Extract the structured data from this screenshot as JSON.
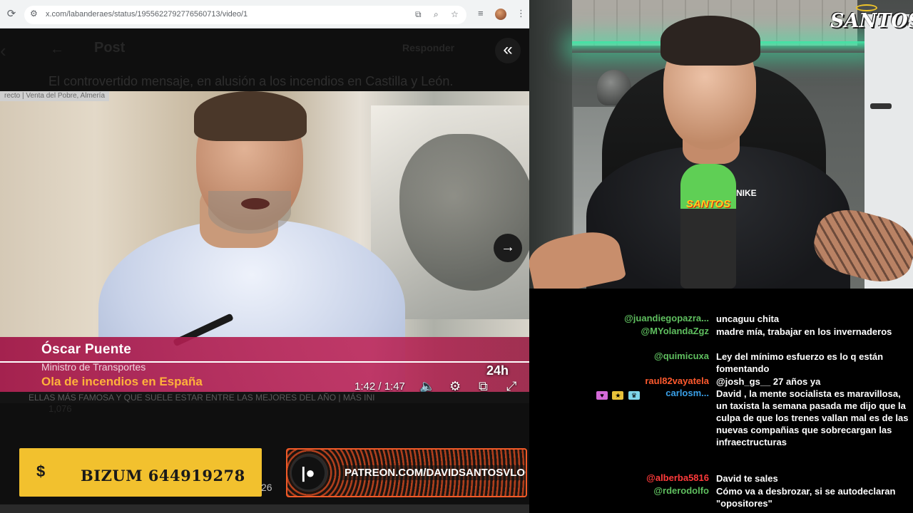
{
  "browser": {
    "url": "x.com/labanderaes/status/1955622792776560713/video/1",
    "dim_back": "←",
    "dim_post_title": "Post",
    "dim_reply": "Responder",
    "dim_caption": "El controvertido mensaje, en alusión a los incendios en Castilla y León.",
    "dim_stats": "1,076"
  },
  "video": {
    "live_tag": "recto | Venta del Pobre, Almería",
    "person_name": "Óscar Puente",
    "person_role": "Ministro de Transportes",
    "topic": "Ola de incendios en España",
    "channel_logo": "24h",
    "time": "1:42 / 1:47",
    "ticker": "ELLAS MÁS FAMOSA Y QUE SUELE ESTAR ENTRE LAS MEJORES DEL AÑO | MÁS INI"
  },
  "overlays": {
    "bizum_symbol": "$",
    "bizum_text": "BIZUM 644919278",
    "bizum_badge": "26",
    "patreon_symbol": "|●",
    "patreon_text": "PATREON.COM/DAVIDSANTOSVLOG"
  },
  "webcam": {
    "logo": "SANTOS",
    "mic_label": "SANTOS",
    "shirt_brand": "NIKE"
  },
  "chat": {
    "messages": [
      {
        "user": "@juandiegopazra...",
        "user_color": "#5fbf5f",
        "text": "uncaguu chita"
      },
      {
        "user": "@MYolandaZgz",
        "user_color": "#5fbf5f",
        "text": "madre mía, trabajar en los invernaderos"
      },
      {
        "user": "@quimicuxa",
        "user_color": "#5fbf5f",
        "text": "Ley del mínimo esfuerzo es lo q están fomentando"
      },
      {
        "user": "raul82vayatela",
        "user_color": "#ff5a2e",
        "text": "@josh_gs__ 27 años ya"
      },
      {
        "user": "carlosm...",
        "user_color": "#3aa0e8",
        "text": "David , la mente socialista es maravillosa, un taxista la semana pasada me dijo que la culpa de que los trenes vallan mal es de las nuevas compañias que sobrecargan las infraectructuras"
      },
      {
        "user": "@alberba5816",
        "user_color": "#ff3a3a",
        "text": "David te sales"
      },
      {
        "user": "@rderodolfo",
        "user_color": "#5fbf5f",
        "text": "Cómo va a desbrozar, si se autodeclaran \"opositores\""
      }
    ]
  }
}
